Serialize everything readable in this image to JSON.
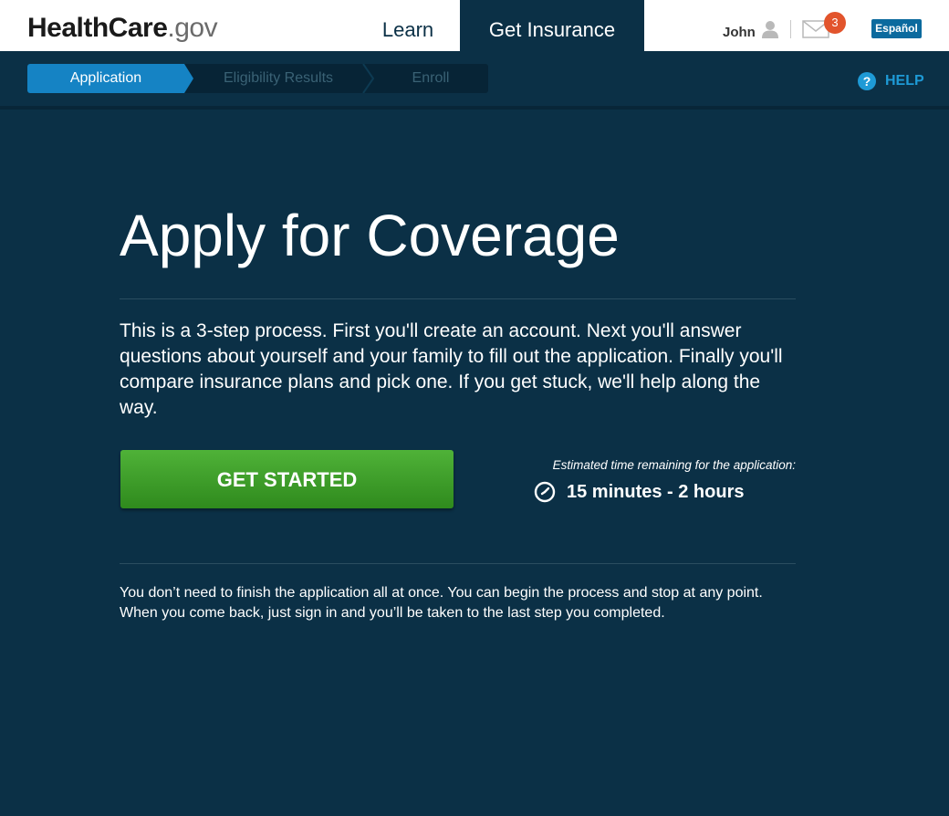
{
  "header": {
    "logo_main": "HealthCare",
    "logo_suffix": ".gov",
    "nav": {
      "learn": "Learn",
      "get_insurance": "Get Insurance"
    },
    "user_name": "John",
    "mail_count": "3",
    "language_button": "Español"
  },
  "progress": {
    "steps": [
      "Application",
      "Eligibility Results",
      "Enroll"
    ],
    "current_step": "Application"
  },
  "help_label": "HELP",
  "help_icon_glyph": "?",
  "main": {
    "title": "Apply for Coverage",
    "intro": "This is a 3-step process. First you'll create an account. Next you'll answer questions about yourself and your family to fill out the application. Finally you'll compare insurance plans and pick one. If you get stuck, we'll help along the way.",
    "cta": "GET STARTED",
    "estimate_label": "Estimated time remaining for the application:",
    "estimate_value": "15 minutes - 2 hours",
    "note": "You don’t need to finish the application all at once. You can begin the process and stop at any point. When you come back, just sign in and you’ll be taken to the last step you completed."
  },
  "colors": {
    "background": "#0b3046",
    "active_step": "#1583c4",
    "cta_green": "#3c9e2a",
    "badge": "#e2542c",
    "help_blue": "#1e9ad6"
  },
  "icons": [
    "user-icon",
    "mail-icon",
    "help-icon",
    "clock-icon"
  ]
}
